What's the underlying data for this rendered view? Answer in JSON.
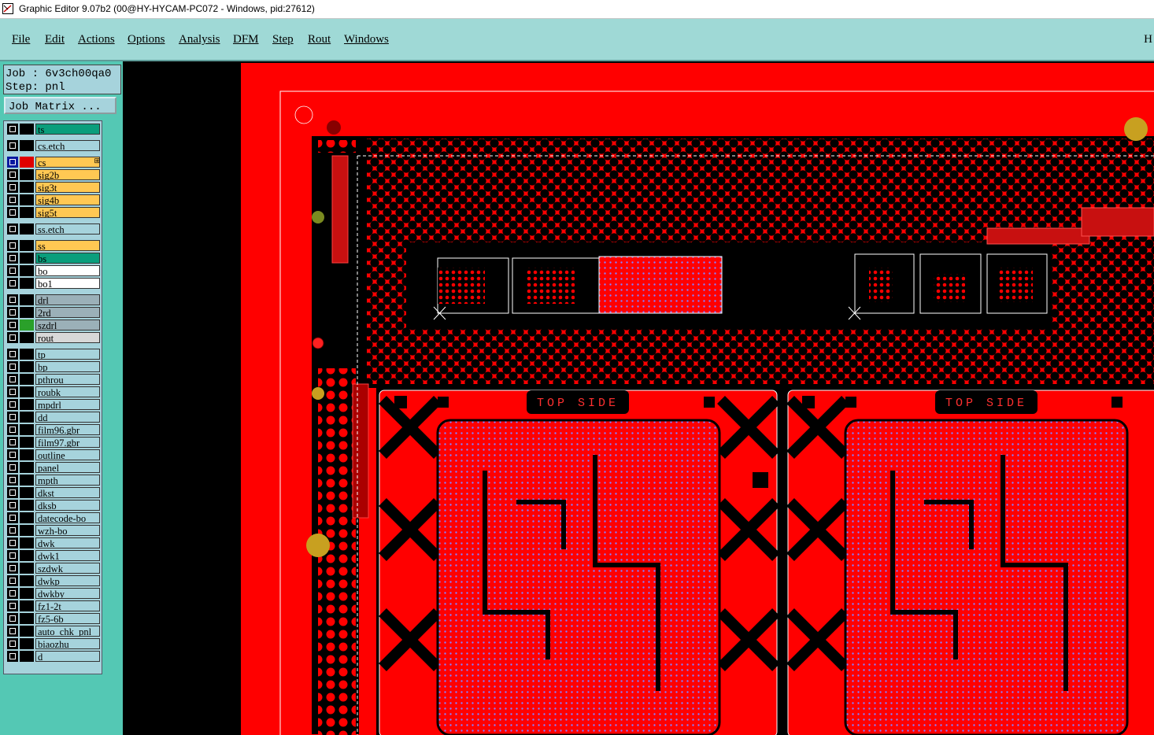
{
  "window": {
    "title": "Graphic Editor 9.07b2 (00@HY-HYCAM-PC072 - Windows, pid:27612)"
  },
  "menu": {
    "items": [
      "File",
      "Edit",
      "Actions",
      "Options",
      "Analysis",
      "DFM",
      "Step",
      "Rout",
      "Windows"
    ],
    "end_label": "H"
  },
  "job": {
    "job_label": "Job : 6v3ch00qa0",
    "step_label": "Step: pnl",
    "matrix_button": "Job Matrix ..."
  },
  "layers": [
    {
      "name": "ts",
      "color": "#0a9e7c",
      "ind": "#000",
      "active": false
    },
    {
      "name": "cs.etch",
      "color": "#a6d3dc",
      "ind": "#000",
      "active": false
    },
    {
      "name": "cs",
      "color": "#ffc853",
      "ind": "#e00000",
      "active": true,
      "flag": "⊞"
    },
    {
      "name": "sig2b",
      "color": "#ffc853",
      "ind": "#000",
      "active": false
    },
    {
      "name": "sig3t",
      "color": "#ffc853",
      "ind": "#000",
      "active": false
    },
    {
      "name": "sig4b",
      "color": "#ffc853",
      "ind": "#000",
      "active": false
    },
    {
      "name": "sig5t",
      "color": "#ffc853",
      "ind": "#000",
      "active": false
    },
    {
      "name": "ss.etch",
      "color": "#a6d3dc",
      "ind": "#000",
      "active": false
    },
    {
      "name": "ss",
      "color": "#ffc853",
      "ind": "#000",
      "active": false
    },
    {
      "name": "bs",
      "color": "#0a9e7c",
      "ind": "#000",
      "active": false
    },
    {
      "name": "bo",
      "color": "#ffffff",
      "ind": "#000",
      "active": false
    },
    {
      "name": "bo1",
      "color": "#ffffff",
      "ind": "#000",
      "active": false
    },
    {
      "name": "drl",
      "color": "#9bb0b8",
      "ind": "#000",
      "active": false
    },
    {
      "name": "2rd",
      "color": "#9bb0b8",
      "ind": "#000",
      "active": false
    },
    {
      "name": "szdrl",
      "color": "#9bb0b8",
      "ind": "#2aa02a",
      "active": false
    },
    {
      "name": "rout",
      "color": "#d8d8d8",
      "ind": "#000",
      "active": false
    },
    {
      "name": "tp",
      "color": "#a6d3dc",
      "ind": "#000",
      "active": false
    },
    {
      "name": "bp",
      "color": "#a6d3dc",
      "ind": "#000",
      "active": false
    },
    {
      "name": "pthrou",
      "color": "#a6d3dc",
      "ind": "#000",
      "active": false
    },
    {
      "name": "roubk",
      "color": "#a6d3dc",
      "ind": "#000",
      "active": false
    },
    {
      "name": "mpdrl",
      "color": "#a6d3dc",
      "ind": "#000",
      "active": false
    },
    {
      "name": "dd",
      "color": "#a6d3dc",
      "ind": "#000",
      "active": false
    },
    {
      "name": "film96.gbr",
      "color": "#a6d3dc",
      "ind": "#000",
      "active": false
    },
    {
      "name": "film97.gbr",
      "color": "#a6d3dc",
      "ind": "#000",
      "active": false
    },
    {
      "name": "outline",
      "color": "#a6d3dc",
      "ind": "#000",
      "active": false
    },
    {
      "name": "panel",
      "color": "#a6d3dc",
      "ind": "#000",
      "active": false
    },
    {
      "name": "mpth",
      "color": "#a6d3dc",
      "ind": "#000",
      "active": false
    },
    {
      "name": "dkst",
      "color": "#a6d3dc",
      "ind": "#000",
      "active": false
    },
    {
      "name": "dksb",
      "color": "#a6d3dc",
      "ind": "#000",
      "active": false
    },
    {
      "name": "datecode-bo",
      "color": "#a6d3dc",
      "ind": "#000",
      "active": false
    },
    {
      "name": "wzh-bo",
      "color": "#a6d3dc",
      "ind": "#000",
      "active": false
    },
    {
      "name": "dwk",
      "color": "#a6d3dc",
      "ind": "#000",
      "active": false
    },
    {
      "name": "dwk1",
      "color": "#a6d3dc",
      "ind": "#000",
      "active": false
    },
    {
      "name": "szdwk",
      "color": "#a6d3dc",
      "ind": "#000",
      "active": false
    },
    {
      "name": "dwkp",
      "color": "#a6d3dc",
      "ind": "#000",
      "active": false
    },
    {
      "name": "dwkby",
      "color": "#a6d3dc",
      "ind": "#000",
      "active": false
    },
    {
      "name": "fz1-2t",
      "color": "#a6d3dc",
      "ind": "#000",
      "active": false
    },
    {
      "name": "fz5-6b",
      "color": "#a6d3dc",
      "ind": "#000",
      "active": false
    },
    {
      "name": "auto_chk_pnl",
      "color": "#a6d3dc",
      "ind": "#000",
      "active": false
    },
    {
      "name": "biaozhu",
      "color": "#a6d3dc",
      "ind": "#000",
      "active": false
    },
    {
      "name": "d",
      "color": "#a6d3dc",
      "ind": "#000",
      "active": false
    }
  ],
  "canvas": {
    "silk_text_left": "TOP SIDE",
    "silk_text_right": "TOP SIDE",
    "colors": {
      "copper": "#ff0000",
      "background": "#000000",
      "outline": "#ffffff",
      "fiducial": "#c8a020",
      "via": "#8a7cff"
    }
  }
}
